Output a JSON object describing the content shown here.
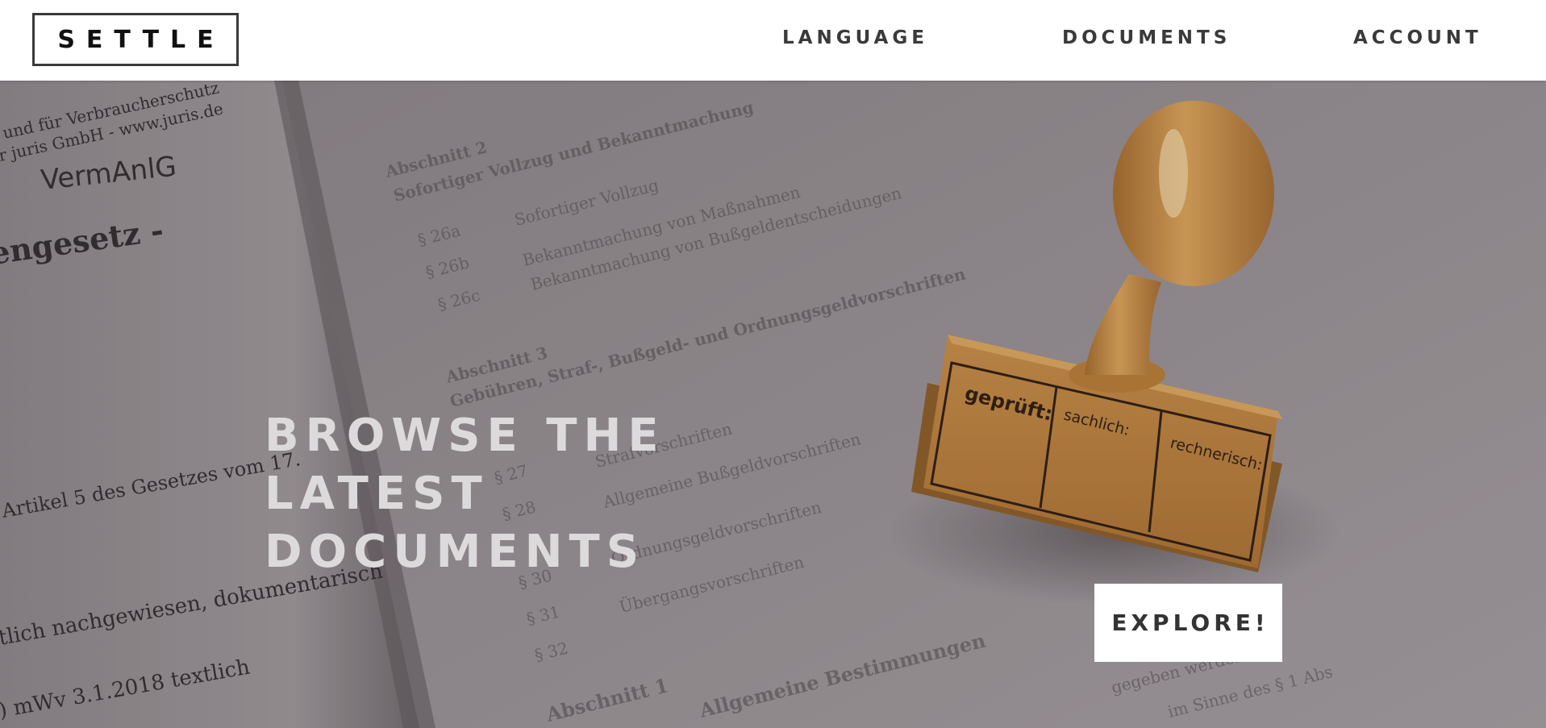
{
  "header": {
    "logo": "SETTLE",
    "nav": {
      "language": "LANGUAGE",
      "documents": "DOCUMENTS",
      "account": "ACCOUNT"
    }
  },
  "hero": {
    "title_lines": [
      "BROWSE THE",
      "LATEST",
      "DOCUMENTS"
    ],
    "cta_label": "EXPLORE!",
    "image": {
      "left_page_text": [
        "und für Verbraucherschutz",
        "r juris GmbH - www.juris.de",
        "VermAnlG",
        "engesetz -",
        "Artikel 5 des Gesetzes vom 17.",
        "tlich nachgewiesen, dokumentarisch",
        ") mWv 3.1.2018 textlich",
        "achgewiesen,"
      ],
      "right_page_text": [
        "Abschnitt 2",
        "Sofortiger Vollzug und Bekanntmachung",
        "§ 26a",
        "§ 26b",
        "§ 26c",
        "Abschnitt 3",
        "§ 27",
        "§ 28",
        "§ 30",
        "§ 31",
        "§ 32",
        "Abschnitt 1",
        "Allgemeine Bestimmungen"
      ],
      "stamp_text": [
        "geprüft:",
        "sachlich:",
        "rechnerisch:"
      ]
    }
  },
  "colors": {
    "header_bg": "#ffffff",
    "nav_text": "#3a3a3a",
    "hero_overlay": "#807a7d",
    "hero_title": "#dcdadb",
    "stamp_wood": "#c0843a"
  }
}
